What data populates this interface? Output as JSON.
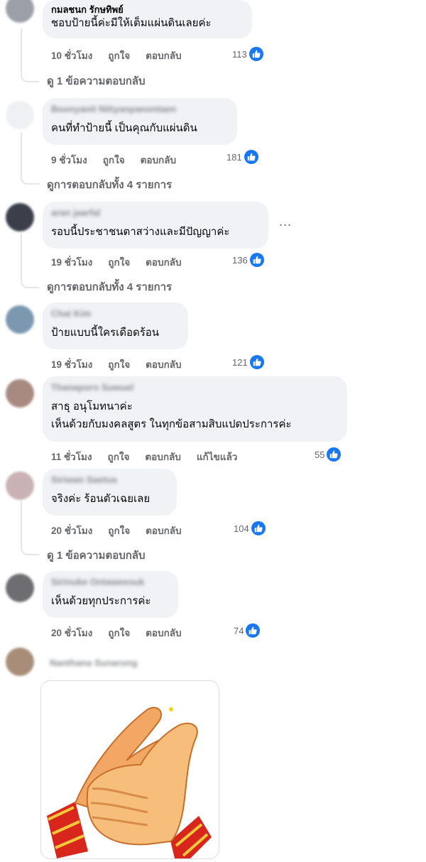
{
  "comments": [
    {
      "author": "กมลชนก รักษทิพย์",
      "lines": [
        "ชอบป้ายนี้ค่ะมีให้เต็มแผ่นดินเลยค่ะ"
      ],
      "time": "10 ชั่วโมง",
      "like": "ถูกใจ",
      "reply": "ตอบกลับ",
      "count": "113",
      "view_replies": "ดู 1 ข้อความตอบกลับ",
      "avatar_color": "#9a9fa8"
    },
    {
      "author": "Boonyanit Nitiyanpanontaen",
      "lines": [
        "คนที่ทำป้ายนี้ เป็นคุณกับแผ่นดิน"
      ],
      "time": "9 ชั่วโมง",
      "like": "ถูกใจ",
      "reply": "ตอบกลับ",
      "count": "181",
      "view_replies": "ดูการตอบกลับทั้ง 4 รายการ",
      "avatar_color": "#eef0f3"
    },
    {
      "author": "aran jaarfal",
      "lines": [
        "รอบนี้ประชาชนตาสว่างและมีปัญญาค่ะ"
      ],
      "time": "19 ชั่วโมง",
      "like": "ถูกใจ",
      "reply": "ตอบกลับ",
      "count": "136",
      "view_replies": "ดูการตอบกลับทั้ง 4 รายการ",
      "more": "...",
      "avatar_color": "#3a3f4a"
    },
    {
      "author": "Chai Kim",
      "lines": [
        "ป้ายแบบนี้ใครเดือดร้อน"
      ],
      "time": "19 ชั่วโมง",
      "like": "ถูกใจ",
      "reply": "ตอบกลับ",
      "count": "121",
      "avatar_color": "#7b98b0"
    },
    {
      "author": "Thanaporn Suwuel",
      "lines": [
        "สาธุ อนุโมทนาค่ะ",
        "เห็นด้วยกับมงคลสูตร ในทุกข้อสามสิบแปดประการค่ะ"
      ],
      "time": "11 ชั่วโมง",
      "like": "ถูกใจ",
      "reply": "ตอบกลับ",
      "edited": "แก้ไขแล้ว",
      "count": "55",
      "avatar_color": "#a88a80"
    },
    {
      "author": "Siriwan Saetua",
      "lines": [
        "จริงค่ะ ร้อนตัวเฉยเลย"
      ],
      "time": "20 ชั่วโมง",
      "like": "ถูกใจ",
      "reply": "ตอบกลับ",
      "count": "104",
      "view_replies": "ดู 1 ข้อความตอบกลับ",
      "avatar_color": "#c9b1b4"
    },
    {
      "author": "Sirinuke Ontaweesuk",
      "lines": [
        "เห็นด้วยทุกประการค่ะ"
      ],
      "time": "20 ชั่วโมง",
      "like": "ถูกใจ",
      "reply": "ตอบกลับ",
      "count": "74",
      "avatar_color": "#6e6e72"
    },
    {
      "author": "Nanthana Sunarong",
      "sticker": "hands-clapping-sticker",
      "avatar_color": "#a88e78"
    }
  ],
  "colors": {
    "like_blue": "#1877f2",
    "meta_gray": "#65676b",
    "bubble_bg": "#f0f2f5"
  }
}
